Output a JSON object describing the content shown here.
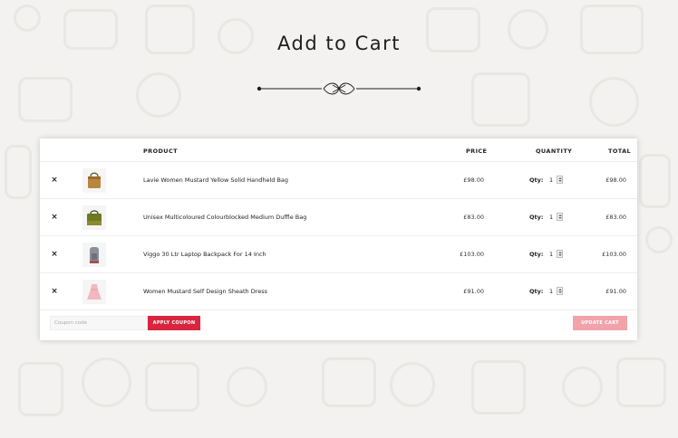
{
  "page": {
    "title": "Add to Cart"
  },
  "cart": {
    "headers": {
      "product": "PRODUCT",
      "price": "PRICE",
      "quantity": "QUANTITY",
      "total": "TOTAL"
    },
    "remove_symbol": "×",
    "qty_label": "Qty:",
    "items": [
      {
        "name": "Lavie Women Mustard Yellow Solid Handheld Bag",
        "price": "£98.00",
        "qty": "1",
        "total": "£98.00",
        "thumb_icon": "handbag-icon"
      },
      {
        "name": "Unisex Multicoloured Colourblocked Medium Duffle Bag",
        "price": "£83.00",
        "qty": "1",
        "total": "£83.00",
        "thumb_icon": "duffle-bag-icon"
      },
      {
        "name": "Viggo 30 Ltr Laptop Backpack For 14 Inch",
        "price": "£103.00",
        "qty": "1",
        "total": "£103.00",
        "thumb_icon": "backpack-icon"
      },
      {
        "name": "Women Mustard Self Design Sheath Dress",
        "price": "£91.00",
        "qty": "1",
        "total": "£91.00",
        "thumb_icon": "dress-icon"
      }
    ],
    "coupon": {
      "placeholder": "Coupon code",
      "value": ""
    },
    "apply_label": "APPLY COUPON",
    "update_label": "UPDATE CART"
  },
  "colors": {
    "apply_button": "#d9253e",
    "update_button": "#f1a3ab",
    "background": "#f3f2f0"
  }
}
